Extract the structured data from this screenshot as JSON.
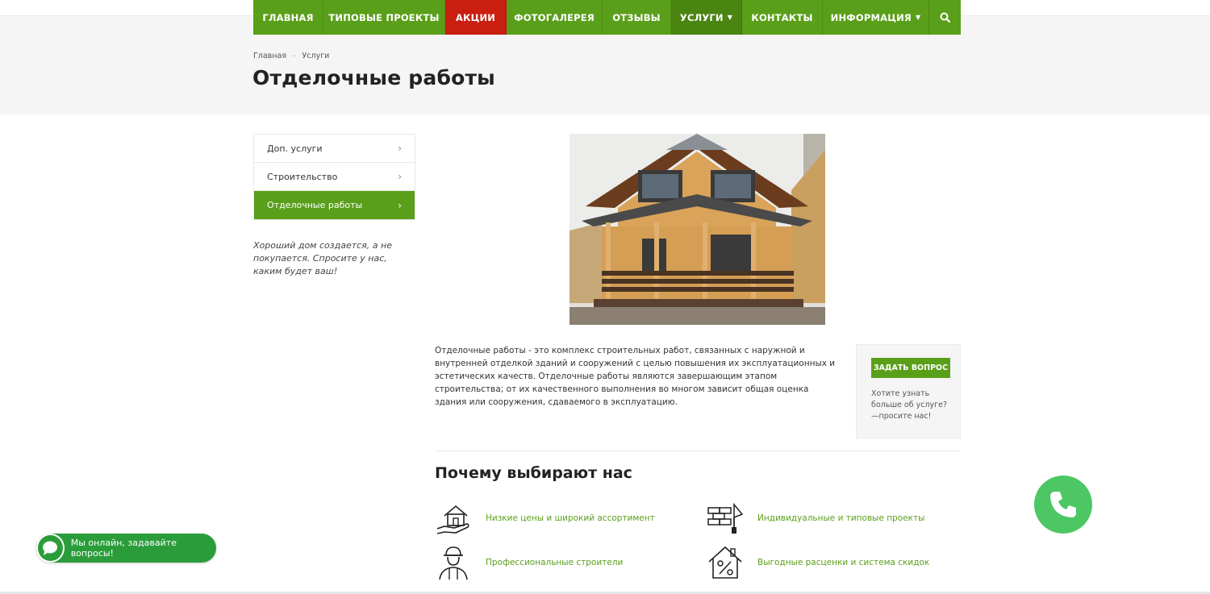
{
  "nav": {
    "items": [
      {
        "label": "ГЛАВНАЯ"
      },
      {
        "label": "ТИПОВЫЕ ПРОЕКТЫ"
      },
      {
        "label": "АКЦИИ"
      },
      {
        "label": "ФОТОГАЛЕРЕЯ"
      },
      {
        "label": "ОТЗЫВЫ"
      },
      {
        "label": "УСЛУГИ"
      },
      {
        "label": "КОНТАКТЫ"
      },
      {
        "label": "ИНФОРМАЦИЯ"
      }
    ],
    "accent_color": "#5a9f1a",
    "promo_color": "#c91e10",
    "search_icon": "search-icon"
  },
  "breadcrumb": {
    "home": "Главная",
    "sep": "-",
    "current": "Услуги"
  },
  "page": {
    "title": "Отделочные работы"
  },
  "sidebar": {
    "items": [
      {
        "label": "Доп. услуги"
      },
      {
        "label": "Строительство"
      },
      {
        "label": "Отделочные работы"
      }
    ],
    "note": "Хороший дом создается, а не покупается. Спросите у нас, каким будет ваш!"
  },
  "content": {
    "description": "Отделочные работы - это комплекс строительных работ, связанных с наружной и внутренней отделкой зданий и сооружений с целью повышения их эксплуатационных и эстетических качеств. Отделочные работы являются завершающим этапом строительства; от их качественного выполнения во многом зависит общая оценка здания или сооружения, сдаваемого в эксплуатацию."
  },
  "ask": {
    "button": "ЗАДАТЬ ВОПРОС",
    "text": "Хотите узнать больше об услуге? —просите нас!"
  },
  "why": {
    "title": "Почему выбирают нас",
    "features": [
      {
        "label": "Низкие цены и широкий ассортимент",
        "icon": "house-hand-icon"
      },
      {
        "label": "Индивидуальные и типовые проекты",
        "icon": "bricks-trowel-icon"
      },
      {
        "label": "Профессиональные строители",
        "icon": "builder-icon"
      },
      {
        "label": "Выгодные расценки и система скидок",
        "icon": "house-percent-icon"
      }
    ]
  },
  "chat": {
    "label": "Мы онлайн, задавайте вопросы!"
  },
  "call": {
    "icon": "phone-icon"
  }
}
